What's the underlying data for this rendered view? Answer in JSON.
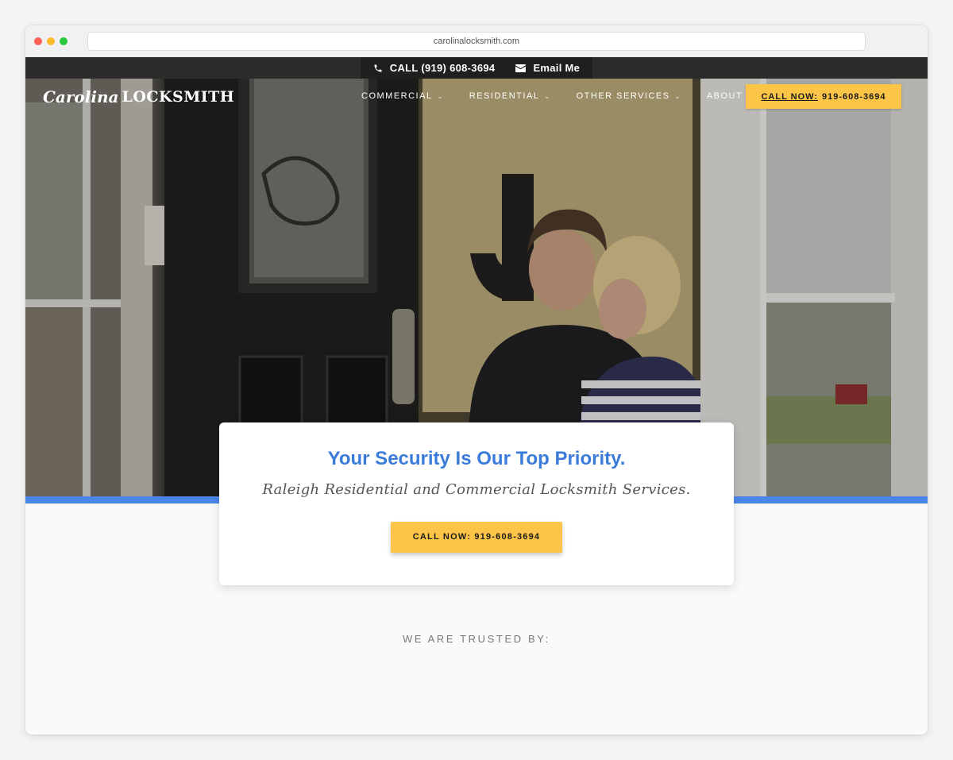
{
  "browser": {
    "url": "carolinalocksmith.com"
  },
  "topbar": {
    "phone_label": "CALL (919) 608-3694",
    "email_label": "Email Me",
    "phone_icon": "phone-icon",
    "email_icon": "envelope-icon"
  },
  "header": {
    "logo_script": "Carolina",
    "logo_main": "LOCKSMITH",
    "nav": [
      {
        "label": "COMMERCIAL",
        "dropdown": true
      },
      {
        "label": "RESIDENTIAL",
        "dropdown": true
      },
      {
        "label": "OTHER SERVICES",
        "dropdown": true
      },
      {
        "label": "ABOUT US",
        "dropdown": false
      }
    ],
    "cta_prefix": "CALL NOW:",
    "cta_number": "919-608-3694"
  },
  "hero_card": {
    "title": "Your Security Is Our Top Priority.",
    "subtitle": "Raleigh Residential and Commercial Locksmith Services.",
    "button_label": "CALL NOW: 919-608-3694"
  },
  "trusted": {
    "heading": "WE ARE TRUSTED BY:"
  },
  "colors": {
    "accent_blue": "#3b7bd9",
    "stripe_blue": "#4a86e8",
    "cta_yellow": "#fcc547",
    "topbar_dark": "#2b2b2b"
  }
}
